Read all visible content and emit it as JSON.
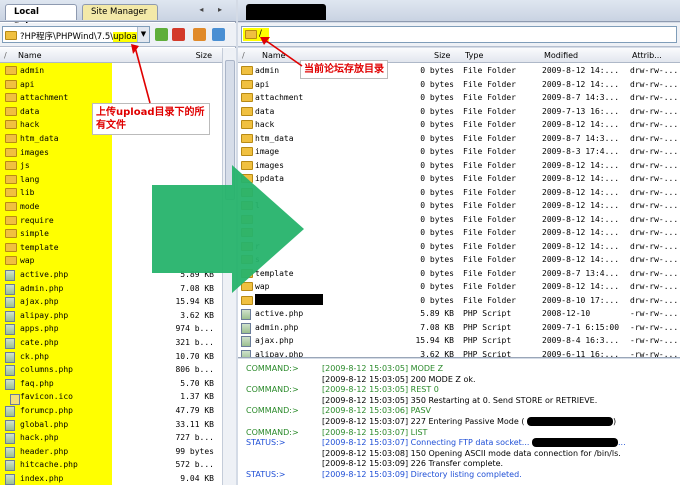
{
  "left": {
    "tabs": [
      "Local Drives",
      "Site Manager"
    ],
    "nav_arrows": "◂ ▸",
    "path_prefix": "?HP程序\\PHPWind\\7.5\\",
    "path_highlight": "upload",
    "columns": {
      "name": "Name",
      "size": "Size"
    },
    "rows": [
      {
        "type": "folder",
        "name": "admin",
        "size": ""
      },
      {
        "type": "folder",
        "name": "api",
        "size": ""
      },
      {
        "type": "folder",
        "name": "attachment",
        "size": ""
      },
      {
        "type": "folder",
        "name": "data",
        "size": ""
      },
      {
        "type": "folder",
        "name": "hack",
        "size": ""
      },
      {
        "type": "folder",
        "name": "htm_data",
        "size": ""
      },
      {
        "type": "folder",
        "name": "images",
        "size": ""
      },
      {
        "type": "folder",
        "name": "js",
        "size": ""
      },
      {
        "type": "folder",
        "name": "lang",
        "size": ""
      },
      {
        "type": "folder",
        "name": "lib",
        "size": ""
      },
      {
        "type": "folder",
        "name": "mode",
        "size": ""
      },
      {
        "type": "folder",
        "name": "require",
        "size": ""
      },
      {
        "type": "folder",
        "name": "simple",
        "size": ""
      },
      {
        "type": "folder",
        "name": "template",
        "size": ""
      },
      {
        "type": "folder",
        "name": "wap",
        "size": ""
      },
      {
        "type": "php",
        "name": "active.php",
        "size": "5.89 KB"
      },
      {
        "type": "php",
        "name": "admin.php",
        "size": "7.08 KB"
      },
      {
        "type": "php",
        "name": "ajax.php",
        "size": "15.94 KB"
      },
      {
        "type": "php",
        "name": "alipay.php",
        "size": "3.62 KB"
      },
      {
        "type": "php",
        "name": "apps.php",
        "size": "974 b..."
      },
      {
        "type": "php",
        "name": "cate.php",
        "size": "321 b..."
      },
      {
        "type": "php",
        "name": "ck.php",
        "size": "10.70 KB"
      },
      {
        "type": "php",
        "name": "columns.php",
        "size": "806 b..."
      },
      {
        "type": "php",
        "name": "faq.php",
        "size": "5.70 KB"
      },
      {
        "type": "ico",
        "name": "favicon.ico",
        "size": "1.37 KB"
      },
      {
        "type": "php",
        "name": "forumcp.php",
        "size": "47.79 KB"
      },
      {
        "type": "php",
        "name": "global.php",
        "size": "33.11 KB"
      },
      {
        "type": "php",
        "name": "hack.php",
        "size": "727 b..."
      },
      {
        "type": "php",
        "name": "header.php",
        "size": "99 bytes"
      },
      {
        "type": "php",
        "name": "hitcache.php",
        "size": "572 b..."
      },
      {
        "type": "php",
        "name": "index.php",
        "size": "9.04 KB"
      }
    ]
  },
  "right": {
    "path": "/",
    "columns": {
      "name": "Name",
      "size": "Size",
      "type": "Type",
      "modified": "Modified",
      "attrib": "Attrib..."
    },
    "rows": [
      {
        "type": "folder",
        "name": "admin",
        "size": "0 bytes",
        "kind": "File Folder",
        "mod": "2009-8-12 14:...",
        "attr": "drw-rw-..."
      },
      {
        "type": "folder",
        "name": "api",
        "size": "0 bytes",
        "kind": "File Folder",
        "mod": "2009-8-12 14:...",
        "attr": "drw-rw-..."
      },
      {
        "type": "folder",
        "name": "attachment",
        "size": "0 bytes",
        "kind": "File Folder",
        "mod": "2009-8-7 14:3...",
        "attr": "drw-rw-..."
      },
      {
        "type": "folder",
        "name": "data",
        "size": "0 bytes",
        "kind": "File Folder",
        "mod": "2009-7-13 16:...",
        "attr": "drw-rw-..."
      },
      {
        "type": "folder",
        "name": "hack",
        "size": "0 bytes",
        "kind": "File Folder",
        "mod": "2009-8-12 14:...",
        "attr": "drw-rw-..."
      },
      {
        "type": "folder",
        "name": "htm_data",
        "size": "0 bytes",
        "kind": "File Folder",
        "mod": "2009-8-7 14:3...",
        "attr": "drw-rw-..."
      },
      {
        "type": "folder",
        "name": "image",
        "size": "0 bytes",
        "kind": "File Folder",
        "mod": "2009-8-3 17:4...",
        "attr": "drw-rw-..."
      },
      {
        "type": "folder",
        "name": "images",
        "size": "0 bytes",
        "kind": "File Folder",
        "mod": "2009-8-12 14:...",
        "attr": "drw-rw-..."
      },
      {
        "type": "folder",
        "name": "ipdata",
        "size": "0 bytes",
        "kind": "File Folder",
        "mod": "2009-8-12 14:...",
        "attr": "drw-rw-..."
      },
      {
        "type": "folder",
        "name": "",
        "size": "0 bytes",
        "kind": "File Folder",
        "mod": "2009-8-12 14:...",
        "attr": "drw-rw-..."
      },
      {
        "type": "folder",
        "name": "l",
        "size": "0 bytes",
        "kind": "File Folder",
        "mod": "2009-8-12 14:...",
        "attr": "drw-rw-..."
      },
      {
        "type": "folder",
        "name": "",
        "size": "0 bytes",
        "kind": "File Folder",
        "mod": "2009-8-12 14:...",
        "attr": "drw-rw-..."
      },
      {
        "type": "folder",
        "name": "",
        "size": "0 bytes",
        "kind": "File Folder",
        "mod": "2009-8-12 14:...",
        "attr": "drw-rw-..."
      },
      {
        "type": "folder",
        "name": "r",
        "size": "0 bytes",
        "kind": "File Folder",
        "mod": "2009-8-12 14:...",
        "attr": "drw-rw-..."
      },
      {
        "type": "folder",
        "name": "s",
        "size": "0 bytes",
        "kind": "File Folder",
        "mod": "2009-8-12 14:...",
        "attr": "drw-rw-..."
      },
      {
        "type": "folder",
        "name": "template",
        "size": "0 bytes",
        "kind": "File Folder",
        "mod": "2009-8-7 13:4...",
        "attr": "drw-rw-..."
      },
      {
        "type": "folder",
        "name": "wap",
        "size": "0 bytes",
        "kind": "File Folder",
        "mod": "2009-8-12 14:...",
        "attr": "drw-rw-..."
      },
      {
        "type": "redacted",
        "name": "",
        "size": "0 bytes",
        "kind": "File Folder",
        "mod": "2009-8-10 17:...",
        "attr": "drw-rw-..."
      },
      {
        "type": "php",
        "name": "active.php",
        "size": "5.89 KB",
        "kind": "PHP Script",
        "mod": "2008-12-10",
        "attr": "-rw-rw-..."
      },
      {
        "type": "php",
        "name": "admin.php",
        "size": "7.08 KB",
        "kind": "PHP Script",
        "mod": "2009-7-1 6:15:00",
        "attr": "-rw-rw-..."
      },
      {
        "type": "php",
        "name": "ajax.php",
        "size": "15.94 KB",
        "kind": "PHP Script",
        "mod": "2009-8-4 16:3...",
        "attr": "-rw-rw-..."
      },
      {
        "type": "php",
        "name": "alipay.php",
        "size": "3.62 KB",
        "kind": "PHP Script",
        "mod": "2009-6-11 16:...",
        "attr": "-rw-rw-..."
      }
    ],
    "log": [
      {
        "k": "COMMAND:>",
        "kc": "cmd",
        "v": "[2009-8-12 15:03:05] MODE Z",
        "vc": "sent"
      },
      {
        "k": "",
        "kc": "",
        "v": "[2009-8-12 15:03:05] 200 MODE Z ok.",
        "vc": "recv"
      },
      {
        "k": "COMMAND:>",
        "kc": "cmd",
        "v": "[2009-8-12 15:03:05] REST 0",
        "vc": "sent"
      },
      {
        "k": "",
        "kc": "",
        "v": "[2009-8-12 15:03:05] 350 Restarting at 0. Send STORE or RETRIEVE.",
        "vc": "recv"
      },
      {
        "k": "COMMAND:>",
        "kc": "cmd",
        "v": "[2009-8-12 15:03:06] PASV",
        "vc": "sent"
      },
      {
        "k": "",
        "kc": "",
        "v": "[2009-8-12 15:03:07] 227 Entering Passive Mode (",
        "vc": "recv",
        "tail": ")"
      },
      {
        "k": "COMMAND:>",
        "kc": "cmd",
        "v": "[2009-8-12 15:03:07] LIST",
        "vc": "sent"
      },
      {
        "k": "STATUS:>",
        "kc": "stat",
        "v": "[2009-8-12 15:03:07] Connecting FTP data socket...",
        "vc": "info",
        "tail": "..."
      },
      {
        "k": "",
        "kc": "",
        "v": "[2009-8-12 15:03:08] 150 Opening ASCII mode data connection for /bin/ls.",
        "vc": "recv"
      },
      {
        "k": "",
        "kc": "",
        "v": "[2009-8-12 15:03:09] 226 Transfer complete.",
        "vc": "recv"
      },
      {
        "k": "STATUS:>",
        "kc": "stat",
        "v": "[2009-8-12 15:03:09] Directory listing completed.",
        "vc": "info"
      }
    ]
  },
  "annotations": {
    "left_note": "上传upload目录下的所有文件",
    "right_note": "当前论坛存放目录"
  },
  "colors": {
    "highlight": "#ffff00",
    "annotation_red": "#e00000",
    "arrow_green": "#26b36b"
  }
}
